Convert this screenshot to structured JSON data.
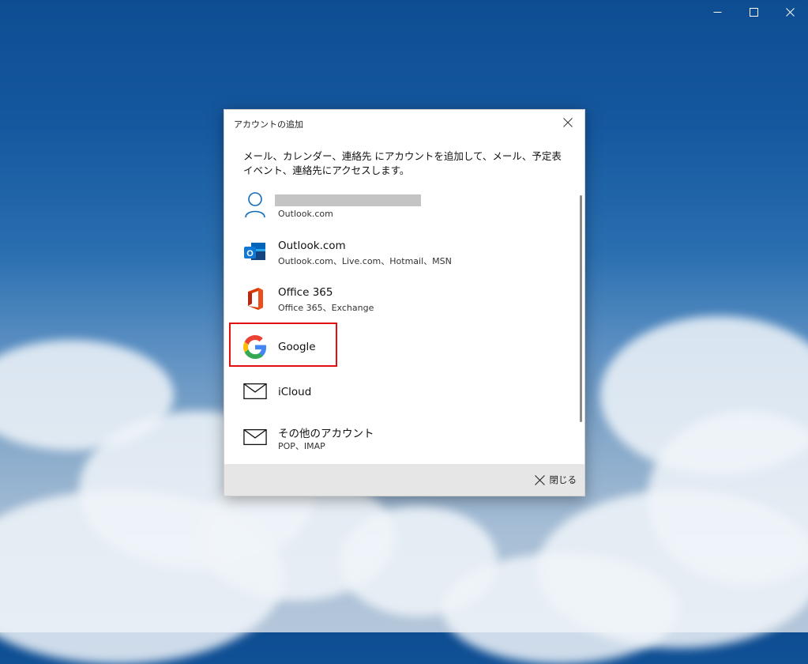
{
  "window": {
    "minimize_icon": "minimize-icon",
    "maximize_icon": "maximize-icon",
    "close_icon": "close-icon"
  },
  "dialog": {
    "title": "アカウントの追加",
    "description": "メール、カレンダー、連絡先 にアカウントを追加して、メール、予定表イベント、連絡先にアクセスします。",
    "accounts": [
      {
        "name": "",
        "sub": "Outlook.com",
        "icon": "person-icon"
      },
      {
        "name": "Outlook.com",
        "sub": "Outlook.com、Live.com、Hotmail、MSN",
        "icon": "outlook-icon"
      },
      {
        "name": "Office 365",
        "sub": "Office 365、Exchange",
        "icon": "office-icon"
      },
      {
        "name": "Google",
        "sub": "",
        "icon": "google-icon"
      },
      {
        "name": "iCloud",
        "sub": "",
        "icon": "mail-icon"
      },
      {
        "name": "その他のアカウント",
        "sub": "POP、IMAP",
        "icon": "mail-icon"
      }
    ],
    "footer": {
      "close_label": "閉じる"
    }
  },
  "colors": {
    "highlight": "#e01010",
    "outlook_blue": "#0f78d4",
    "office_red": "#d83b01"
  }
}
